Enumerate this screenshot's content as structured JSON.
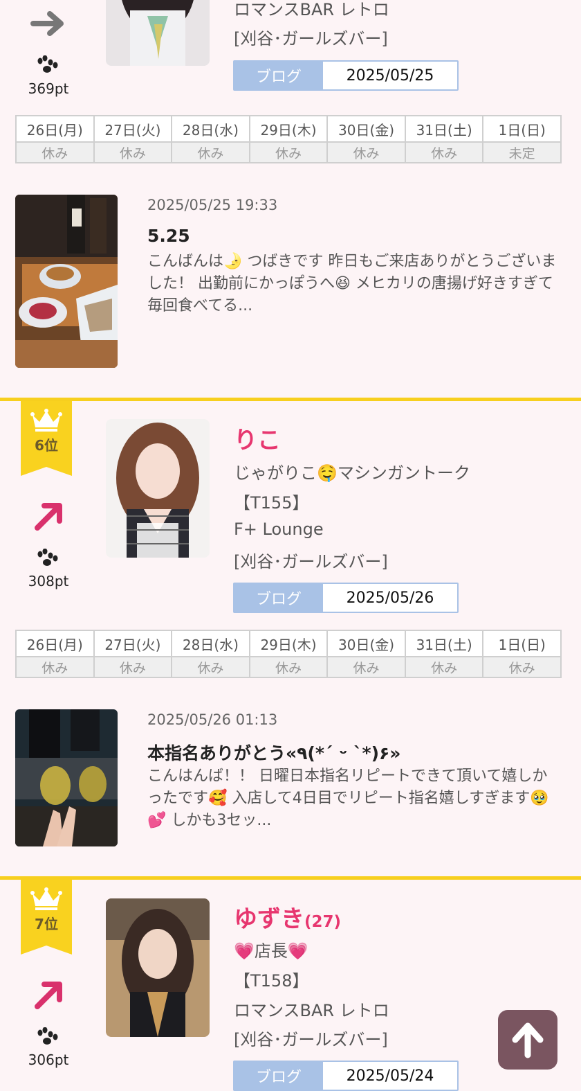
{
  "entries": [
    {
      "store": "ロマンスBAR レトロ",
      "area": "[刈谷･ガールズバー]",
      "blog_label": "ブログ",
      "blog_date": "2025/05/25",
      "points": "369pt",
      "trend": "right-arrow-icon",
      "schedule_days": [
        "26日(月)",
        "27日(火)",
        "28日(水)",
        "29日(木)",
        "30日(金)",
        "31日(土)",
        "1日(日)"
      ],
      "schedule_status": [
        "休み",
        "休み",
        "休み",
        "休み",
        "休み",
        "休み",
        "未定"
      ],
      "post": {
        "time": "2025/05/25 19:33",
        "title": "5.25",
        "body": "こんばんは🌛 つばきです 昨日もご来店ありがとうございました！ 出勤前にかっぽうへ😆 メヒカリの唐揚げ好きすぎて毎回食べてる..."
      }
    },
    {
      "rank": "6位",
      "name": "りこ",
      "catch": "じゃがりこ🤤マシンガントーク",
      "height": "【T155】",
      "store": "F+ Lounge",
      "area": "[刈谷･ガールズバー]",
      "blog_label": "ブログ",
      "blog_date": "2025/05/26",
      "points": "308pt",
      "trend": "up-right-arrow-icon",
      "schedule_days": [
        "26日(月)",
        "27日(火)",
        "28日(水)",
        "29日(木)",
        "30日(金)",
        "31日(土)",
        "1日(日)"
      ],
      "schedule_status": [
        "休み",
        "休み",
        "休み",
        "休み",
        "休み",
        "休み",
        "休み"
      ],
      "post": {
        "time": "2025/05/26 01:13",
        "title": "本指名ありがとう«٩(*´ ᵕ `*)۶»",
        "body": "こんはんば！！ 日曜日本指名リピートできて頂いて嬉しかったです🥰 入店して4日目でリピート指名嬉しすぎます🥹💕 しかも3セッ..."
      }
    },
    {
      "rank": "7位",
      "name": "ゆずき",
      "age": "(27)",
      "catch": "💗店長💗",
      "height": "【T158】",
      "store": "ロマンスBAR レトロ",
      "area": "[刈谷･ガールズバー]",
      "blog_label": "ブログ",
      "blog_date": "2025/05/24",
      "points": "306pt",
      "trend": "up-right-arrow-icon"
    }
  ],
  "colors": {
    "background": "#fdf4f6",
    "name": "#e7366f",
    "rank_ribbon": "#f9d21f",
    "separator": "#f7cf1e",
    "blog_button": "#a9c2e6",
    "saturday": "#4ec1c7",
    "sunday": "#f07aa3",
    "trend_up": "#d9316c",
    "trend_flat": "#777777",
    "to_top_button": "#7a5560"
  }
}
